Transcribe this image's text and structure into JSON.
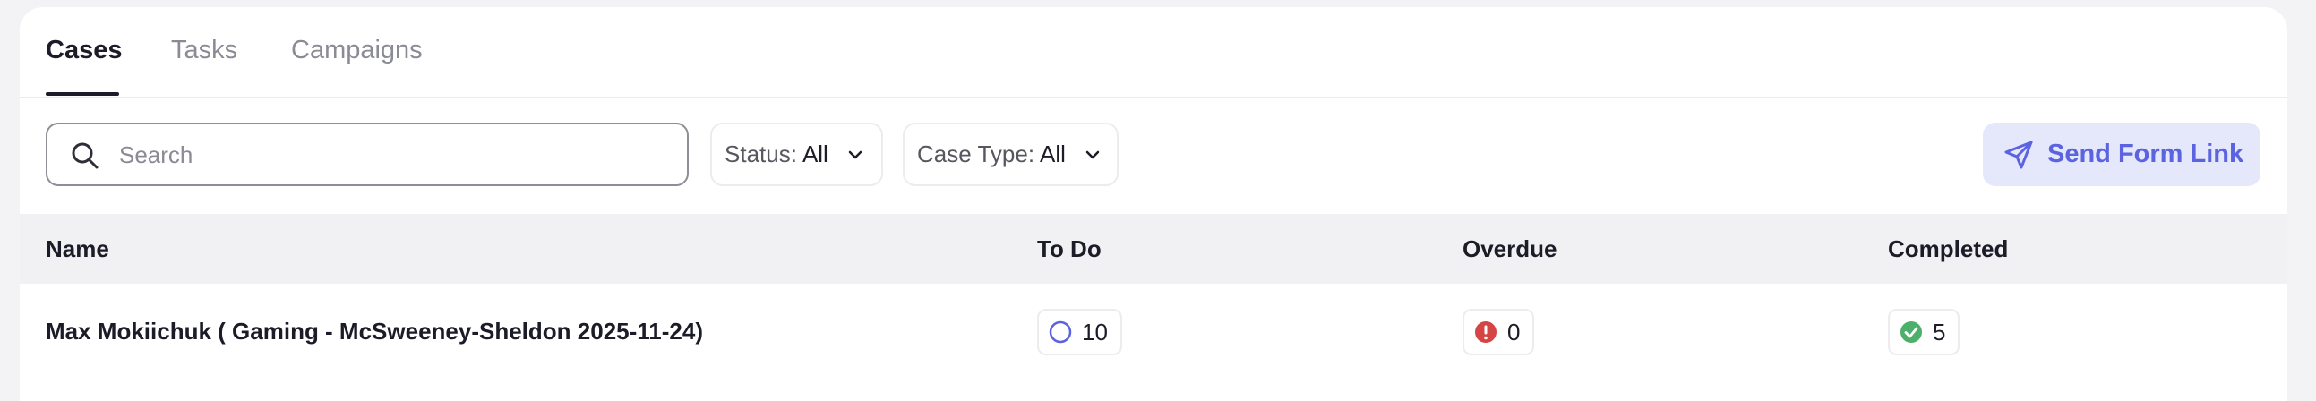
{
  "tabs": [
    {
      "label": "Cases",
      "active": true
    },
    {
      "label": "Tasks",
      "active": false
    },
    {
      "label": "Campaigns",
      "active": false
    }
  ],
  "search": {
    "placeholder": "Search",
    "value": "",
    "icon": "search-icon"
  },
  "filters": {
    "status": {
      "label": "Status:",
      "value": "All",
      "icon": "chevron-down-icon"
    },
    "case_type": {
      "label": "Case Type:",
      "value": "All",
      "icon": "chevron-down-icon"
    }
  },
  "actions": {
    "send_form_link": {
      "label": "Send Form Link",
      "icon": "paper-plane-icon",
      "color": "#5b63e0",
      "background": "#e5e7fb"
    }
  },
  "table": {
    "columns": [
      "Name",
      "To Do",
      "Overdue",
      "Completed"
    ],
    "rows": [
      {
        "name": "Max Mokiichuk ( Gaming - McSweeney-Sheldon 2025-11-24)",
        "todo": "10",
        "overdue": "0",
        "completed": "5"
      }
    ]
  },
  "colors": {
    "todo_icon": "#5b63e0",
    "overdue_icon": "#d64545",
    "completed_icon": "#4caf6a"
  }
}
